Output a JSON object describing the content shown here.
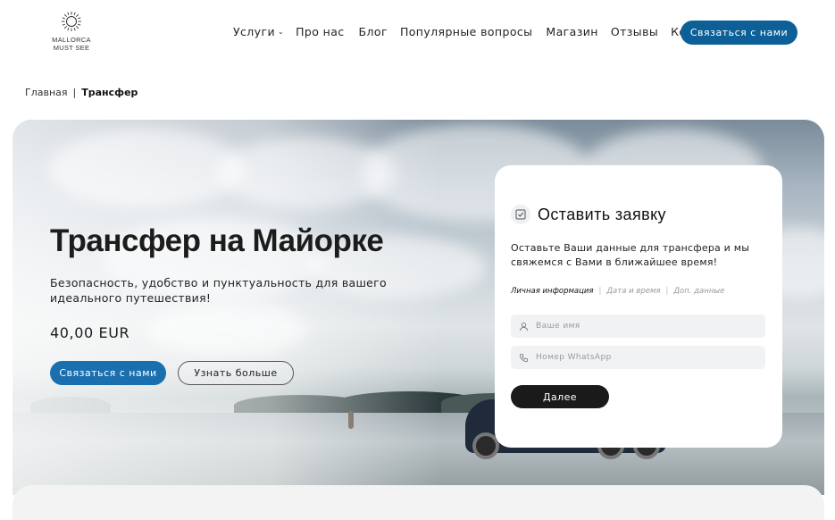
{
  "header": {
    "logo_text_line1": "MALLORCA",
    "logo_text_line2": "MUST SEE",
    "nav": [
      {
        "label": "Услуги",
        "has_dropdown": true
      },
      {
        "label": "Про нас"
      },
      {
        "label": "Блог"
      },
      {
        "label": "Популярные вопросы"
      },
      {
        "label": "Магазин"
      },
      {
        "label": "Отзывы"
      },
      {
        "label": "Контакты"
      }
    ],
    "contact_button": "Связаться с нами"
  },
  "breadcrumb": {
    "home": "Главная",
    "separator": "|",
    "current": "Трансфер"
  },
  "hero": {
    "title": "Трансфер на Майорке",
    "subtitle": "Безопасность, удобство и пунктуальность для вашего идеального путешествия!",
    "price": "40,00 EUR",
    "primary_button": "Связаться с нами",
    "secondary_button": "Узнать больше"
  },
  "form": {
    "title": "Оставить заявку",
    "description": "Оставьте Ваши данные для трансфера и мы свяжемся с Вами в ближайшее время!",
    "steps": [
      "Личная информация",
      "Дата и время",
      "Доп. данные"
    ],
    "name_placeholder": "Ваше имя",
    "phone_placeholder": "Номер WhatsApp",
    "next_button": "Далее"
  },
  "colors": {
    "brand_blue": "#0d6097",
    "button_blue": "#1a6fae",
    "dark_button": "#1a1a1a"
  }
}
